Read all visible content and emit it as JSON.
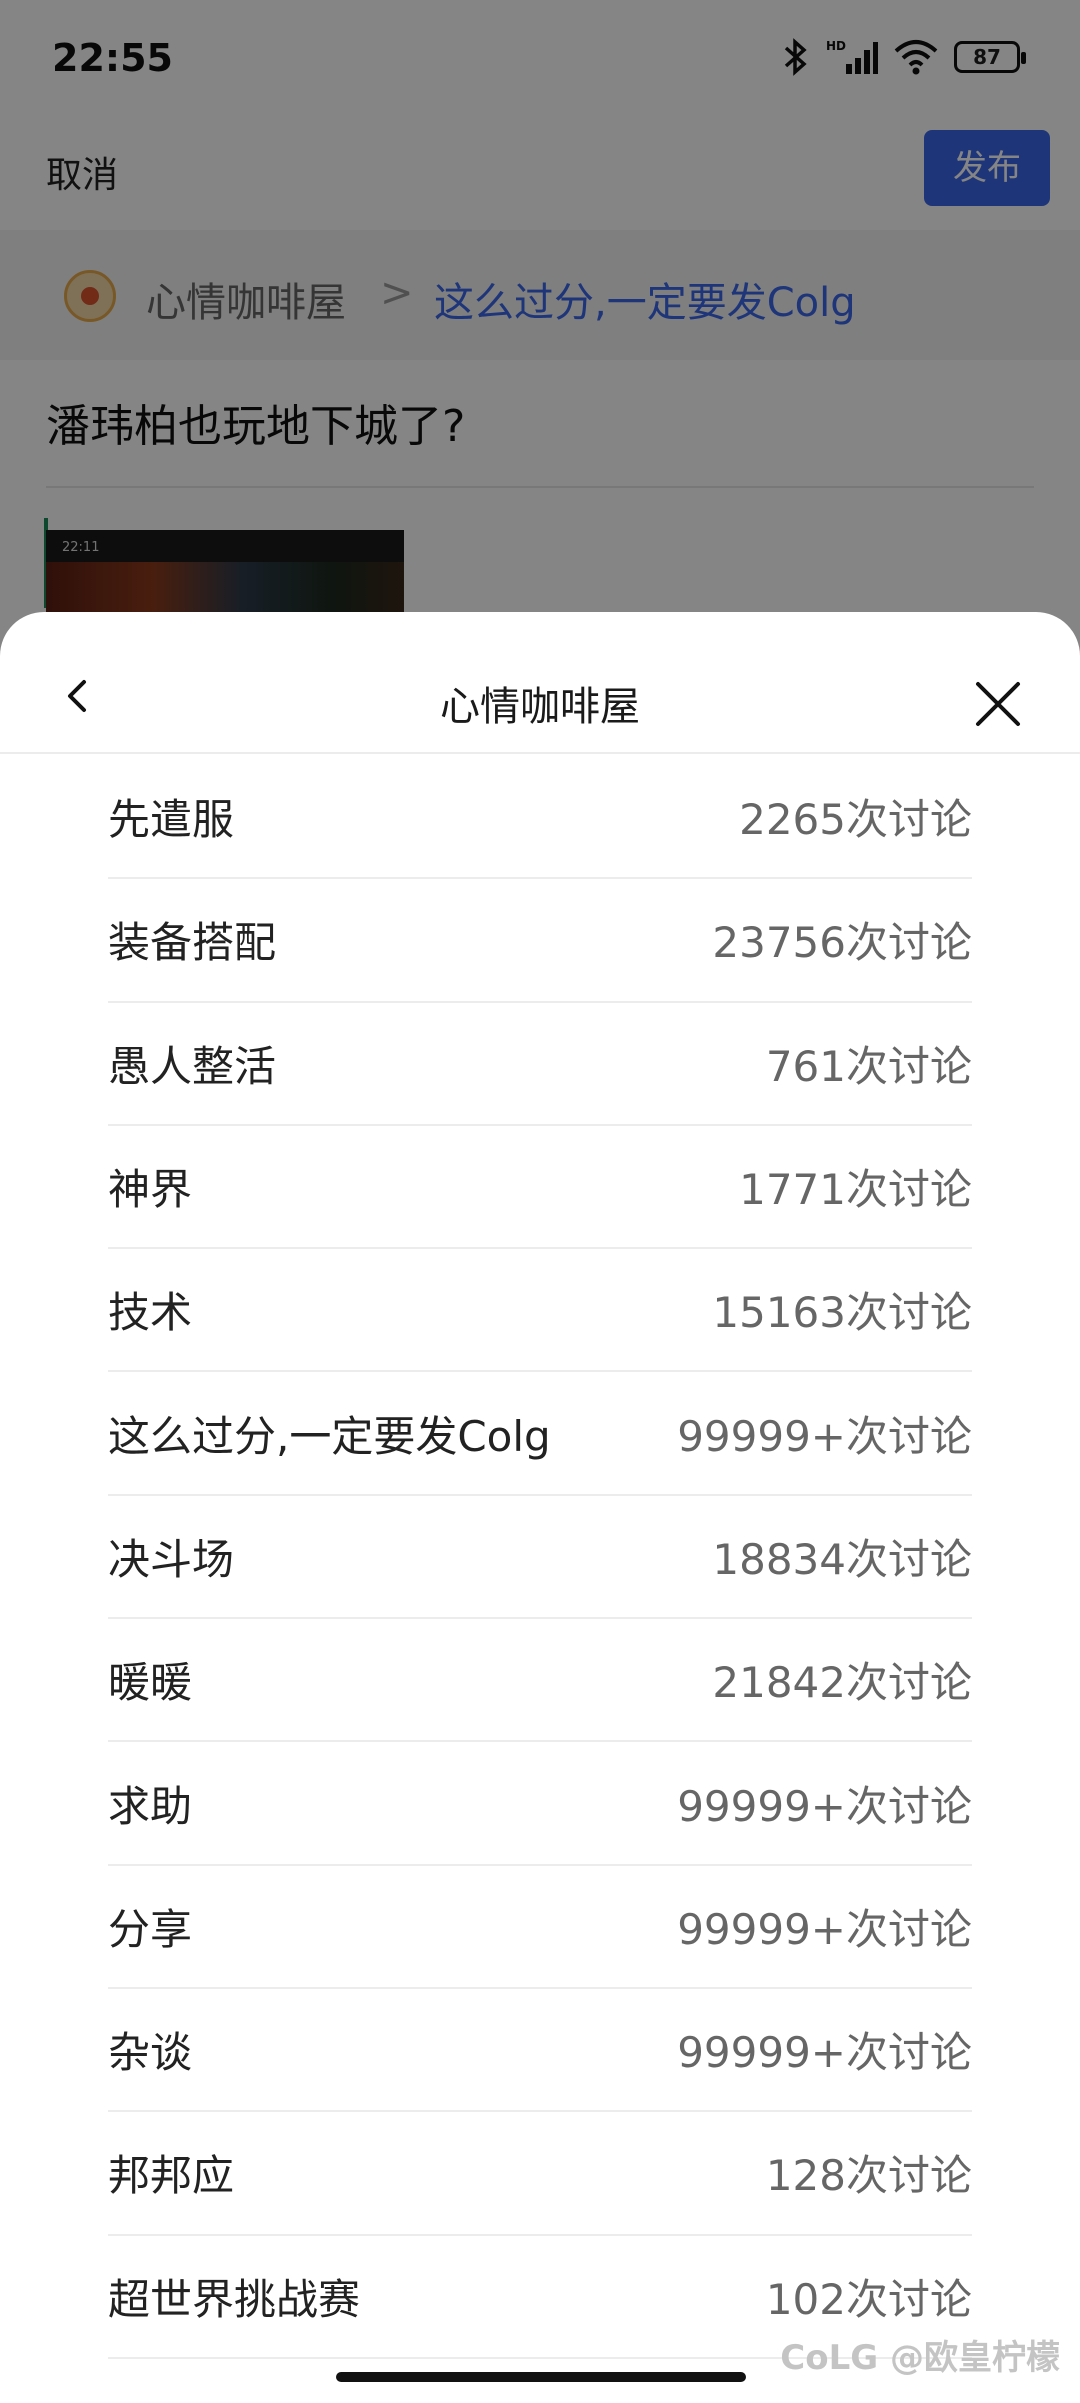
{
  "status": {
    "time": "22:55",
    "battery": "87"
  },
  "top_bar": {
    "cancel": "取消",
    "publish": "发布"
  },
  "breadcrumb": {
    "forum": "心情咖啡屋",
    "separator": ">",
    "topic": "这么过分,一定要发Colg"
  },
  "post": {
    "title": "潘玮柏也玩地下城了?",
    "thumb_time": "22:11"
  },
  "sheet": {
    "title": "心情咖啡屋",
    "items": [
      {
        "name": "先遣服",
        "count": "2265次讨论"
      },
      {
        "name": "装备搭配",
        "count": "23756次讨论"
      },
      {
        "name": "愚人整活",
        "count": "761次讨论"
      },
      {
        "name": "神界",
        "count": "1771次讨论"
      },
      {
        "name": "技术",
        "count": "15163次讨论"
      },
      {
        "name": "这么过分,一定要发Colg",
        "count": "99999+次讨论"
      },
      {
        "name": "决斗场",
        "count": "18834次讨论"
      },
      {
        "name": "暖暖",
        "count": "21842次讨论"
      },
      {
        "name": "求助",
        "count": "99999+次讨论"
      },
      {
        "name": "分享",
        "count": "99999+次讨论"
      },
      {
        "name": "杂谈",
        "count": "99999+次讨论"
      },
      {
        "name": "邦邦应",
        "count": "128次讨论"
      },
      {
        "name": "超世界挑战赛",
        "count": "102次讨论"
      }
    ]
  },
  "watermark": "CoLG @欧皇柠檬",
  "colors": {
    "accent": "#3a66e8",
    "overlay": "rgba(0,0,0,0.48)"
  }
}
